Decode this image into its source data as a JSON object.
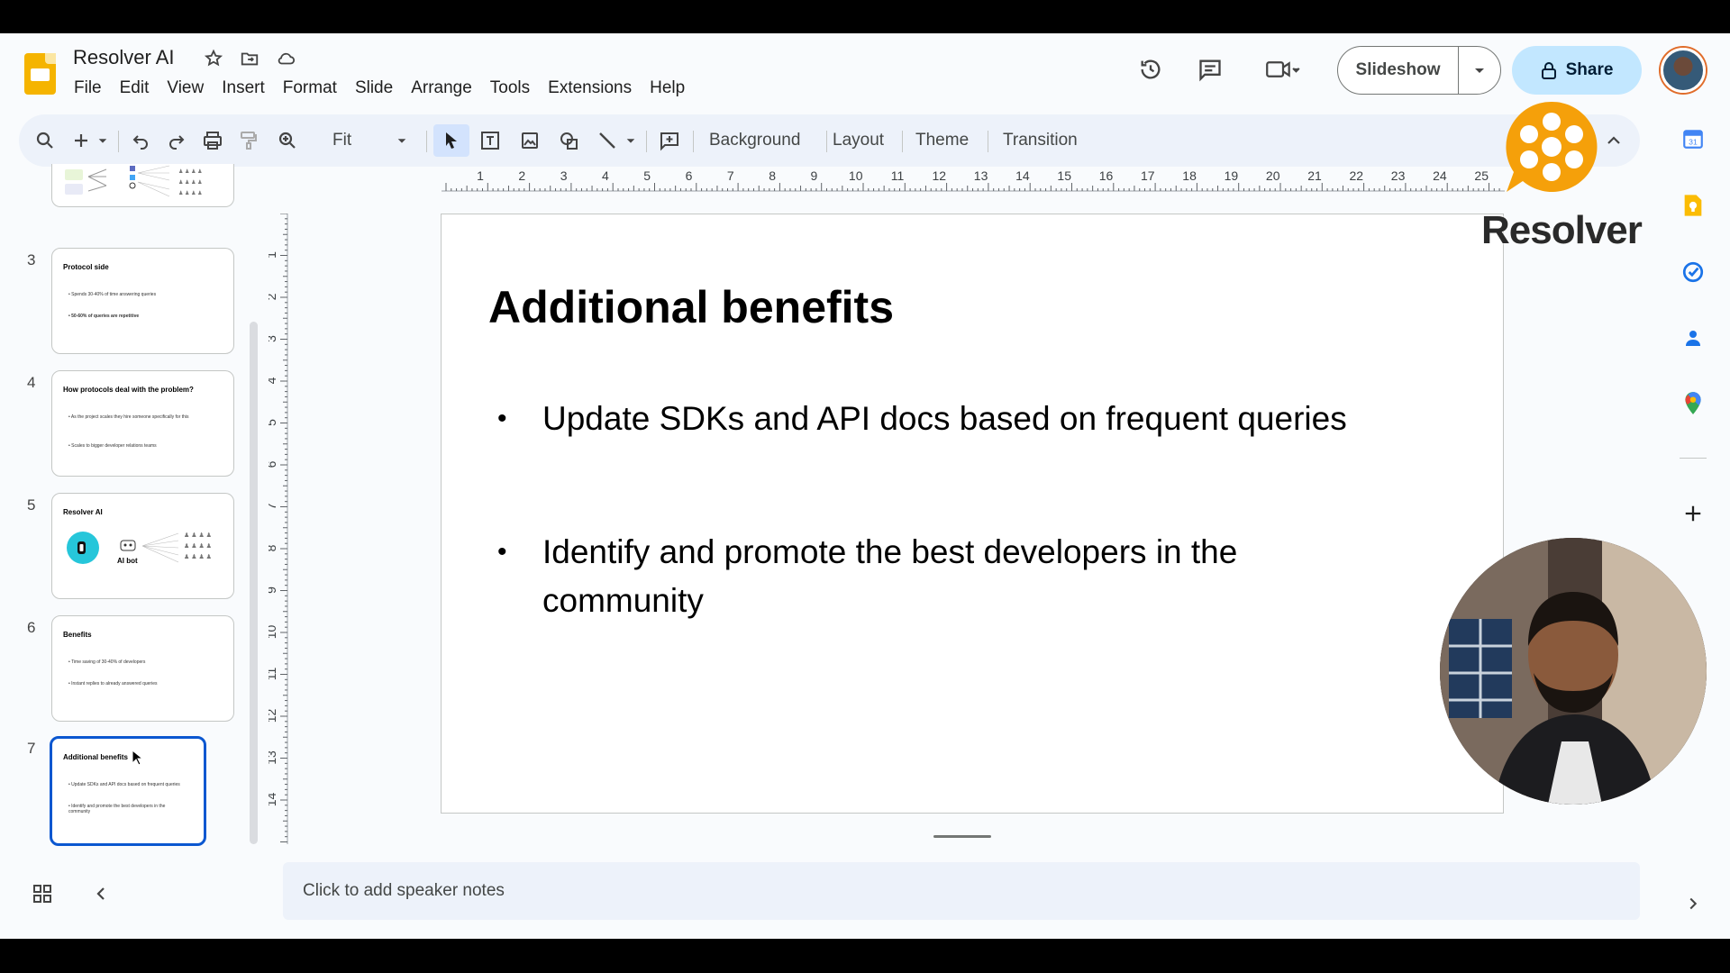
{
  "app": {
    "title": "Resolver AI",
    "menus": [
      "File",
      "Edit",
      "View",
      "Insert",
      "Format",
      "Slide",
      "Arrange",
      "Tools",
      "Extensions",
      "Help"
    ]
  },
  "header": {
    "slideshow_label": "Slideshow",
    "share_label": "Share"
  },
  "toolbar": {
    "zoom_value": "Fit",
    "background_label": "Background",
    "layout_label": "Layout",
    "theme_label": "Theme",
    "transition_label": "Transition"
  },
  "ruler": {
    "h_ticks": [
      "1",
      "2",
      "3",
      "4",
      "5",
      "6",
      "7",
      "8",
      "9",
      "10",
      "11",
      "12",
      "13",
      "14",
      "15",
      "16",
      "17",
      "18",
      "19",
      "20",
      "21",
      "22",
      "23",
      "24",
      "25"
    ],
    "v_ticks": [
      "1",
      "2",
      "3",
      "4",
      "5",
      "6",
      "7",
      "8",
      "9",
      "10",
      "11",
      "12",
      "13",
      "14"
    ]
  },
  "filmstrip": {
    "slides": [
      {
        "num": "3",
        "title": "Protocol side",
        "bullets": [
          "Spends 30-40% of time answering queries",
          "50-60% of queries are repetitive"
        ]
      },
      {
        "num": "4",
        "title": "How protocols deal with the problem?",
        "bullets": [
          "As the project scales they hire someone specifically for this",
          "Scales to bigger developer relations teams"
        ]
      },
      {
        "num": "5",
        "title": "Resolver AI",
        "bullets": [
          "AI bot"
        ]
      },
      {
        "num": "6",
        "title": "Benefits",
        "bullets": [
          "Time saving of 30-40% of developers",
          "Instant replies to already answered queries"
        ]
      },
      {
        "num": "7",
        "title": "Additional benefits",
        "bullets": [
          "Update SDKs and API docs based on frequent queries",
          "Identify and promote the best developers in the community"
        ]
      }
    ]
  },
  "slide": {
    "title": "Additional benefits",
    "bullets": [
      "Update SDKs and API docs based on frequent queries",
      "Identify and promote the best developers in the community"
    ]
  },
  "notes": {
    "placeholder": "Click to add speaker notes"
  },
  "watermark": {
    "text": "Resolver"
  },
  "colors": {
    "accent": "#0b57d0",
    "share_bg": "#c2e7ff",
    "toolbar_bg": "#edf2fa",
    "logo_orange": "#f5a00a"
  }
}
